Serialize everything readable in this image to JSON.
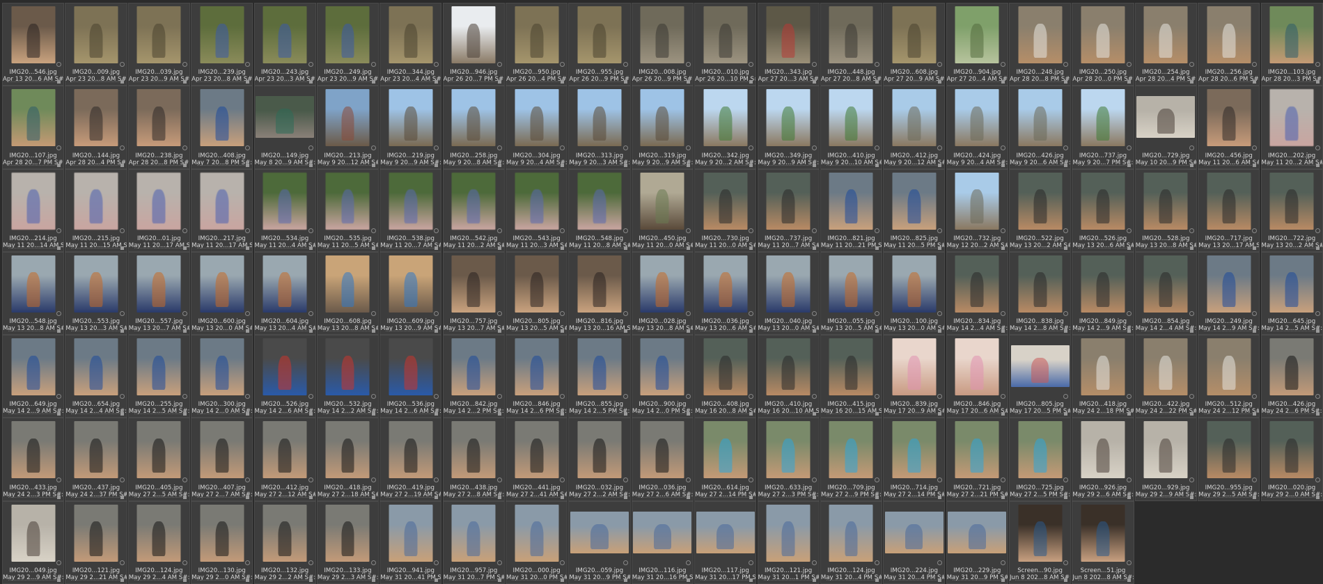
{
  "window": {
    "title": ""
  },
  "thumbnails": [
    {
      "name": "IMG20...546.jpg",
      "date": "Apr 13 20...6 AM S#:",
      "palette": "portrait-dark"
    },
    {
      "name": "IMG20...009.jpg",
      "date": "Apr 23 20...8 AM S#:",
      "palette": "forest"
    },
    {
      "name": "IMG20...039.jpg",
      "date": "Apr 23 20...9 AM S#:",
      "palette": "forest"
    },
    {
      "name": "IMG20...239.jpg",
      "date": "Apr 23 20...8 AM S#:",
      "palette": "forest-blue"
    },
    {
      "name": "IMG20...243.jpg",
      "date": "Apr 23 20...3 AM S#:",
      "palette": "forest-blue"
    },
    {
      "name": "IMG20...249.jpg",
      "date": "Apr 23 20...9 AM S#:",
      "palette": "forest-blue"
    },
    {
      "name": "IMG20...344.jpg",
      "date": "Apr 23 20...4 AM S#:",
      "palette": "forest"
    },
    {
      "name": "IMG20...946.jpg",
      "date": "Apr 26 20...7 PM S#:",
      "palette": "rock-sky"
    },
    {
      "name": "IMG20...950.jpg",
      "date": "Apr 26 20...4 PM S#:",
      "palette": "forest"
    },
    {
      "name": "IMG20...955.jpg",
      "date": "Apr 26 20...9 PM S#:",
      "palette": "forest"
    },
    {
      "name": "IMG20...008.jpg",
      "date": "Apr 26 20...9 PM S#:",
      "palette": "camp"
    },
    {
      "name": "IMG20...010.jpg",
      "date": "Apr 26 20...10 PM S#:",
      "palette": "camp"
    },
    {
      "name": "IMG20...343.jpg",
      "date": "Apr 27 20...3 AM S#:",
      "palette": "camp-red"
    },
    {
      "name": "IMG20...448.jpg",
      "date": "Apr 27 20...8 AM S#:",
      "palette": "camp"
    },
    {
      "name": "IMG20...608.jpg",
      "date": "Apr 27 20...9 AM S#:",
      "palette": "forest"
    },
    {
      "name": "IMG20...904.jpg",
      "date": "Apr 27 20...4 AM S#:",
      "palette": "green"
    },
    {
      "name": "IMG20...248.jpg",
      "date": "Apr 28 20...8 PM S#:",
      "palette": "boy-white"
    },
    {
      "name": "IMG20...250.jpg",
      "date": "Apr 28 20...0 PM S#:",
      "palette": "boy-white"
    },
    {
      "name": "IMG20...254.jpg",
      "date": "Apr 28 20...4 PM S#:",
      "palette": "boy-white"
    },
    {
      "name": "IMG20...256.jpg",
      "date": "Apr 28 20...6 PM S#:",
      "palette": "boy-white"
    },
    {
      "name": "IMG20...103.jpg",
      "date": "Apr 28 20...3 PM S#:",
      "palette": "boy-green"
    },
    {
      "name": "IMG20...107.jpg",
      "date": "Apr 28 20...7 PM S#:",
      "palette": "boy-green"
    },
    {
      "name": "IMG20...144.jpg",
      "date": "Apr 28 20...4 PM S#:",
      "palette": "group"
    },
    {
      "name": "IMG20...238.jpg",
      "date": "Apr 28 20...8 PM S#:",
      "palette": "group"
    },
    {
      "name": "IMG20...408.jpg",
      "date": "May 7 20...8 PM S#:",
      "palette": "portrait-blue"
    },
    {
      "name": "IMG20...149.jpg",
      "date": "May 8 20...9 AM S#:",
      "palette": "table",
      "wide": true
    },
    {
      "name": "IMG20...213.jpg",
      "date": "May 9 20...12 AM S#:",
      "palette": "truck"
    },
    {
      "name": "IMG20...219.jpg",
      "date": "May 9 20...9 AM S#:",
      "palette": "field-sky"
    },
    {
      "name": "IMG20...258.jpg",
      "date": "May 9 20...8 AM S#:",
      "palette": "field-sky"
    },
    {
      "name": "IMG20...304.jpg",
      "date": "May 9 20...4 AM S#:",
      "palette": "field-sky"
    },
    {
      "name": "IMG20...313.jpg",
      "date": "May 9 20...3 AM S#:",
      "palette": "field-sky"
    },
    {
      "name": "IMG20...319.jpg",
      "date": "May 9 20...9 AM S#:",
      "palette": "field-sky"
    },
    {
      "name": "IMG20...342.jpg",
      "date": "May 9 20...2 AM S#:",
      "palette": "field-tree"
    },
    {
      "name": "IMG20...349.jpg",
      "date": "May 9 20...9 AM S#:",
      "palette": "field-tree"
    },
    {
      "name": "IMG20...410.jpg",
      "date": "May 9 20...10 AM S#:",
      "palette": "field-tree"
    },
    {
      "name": "IMG20...412.jpg",
      "date": "May 9 20...12 AM S#:",
      "palette": "field-man"
    },
    {
      "name": "IMG20...424.jpg",
      "date": "May 9 20...4 AM S#:",
      "palette": "field-man"
    },
    {
      "name": "IMG20...426.jpg",
      "date": "May 9 20...6 AM S#:",
      "palette": "field-man"
    },
    {
      "name": "IMG20...737.jpg",
      "date": "May 9 20...7 PM S#:",
      "palette": "field-tree"
    },
    {
      "name": "IMG20...729.jpg",
      "date": "May 10 20...9 PM S#:",
      "palette": "hut",
      "wide": true
    },
    {
      "name": "IMG20...456.jpg",
      "date": "May 11 20...6 AM S#:",
      "palette": "group"
    },
    {
      "name": "IMG20...202.jpg",
      "date": "May 11 20...2 AM S#:",
      "palette": "blurred",
      "blur": true
    },
    {
      "name": "IMG20...214.jpg",
      "date": "May 11 20...14 AM S#:",
      "palette": "blurred",
      "blur": true
    },
    {
      "name": "IMG20...215.jpg",
      "date": "May 11 20...15 AM S#:",
      "palette": "blurred",
      "blur": true
    },
    {
      "name": "IMG20...01.jpg",
      "date": "May 11 20...17 AM S#:",
      "palette": "blurred",
      "blur": true
    },
    {
      "name": "IMG20...217.jpg",
      "date": "May 11 20...17 AM S#:",
      "palette": "blurred",
      "blur": true
    },
    {
      "name": "IMG20...534.jpg",
      "date": "May 11 20...4 AM S#:",
      "palette": "blurred-trees",
      "blur": true
    },
    {
      "name": "IMG20...535.jpg",
      "date": "May 11 20...5 AM S#:",
      "palette": "blurred-trees",
      "blur": true
    },
    {
      "name": "IMG20...538.jpg",
      "date": "May 11 20...7 AM S#:",
      "palette": "blurred-trees",
      "blur": true
    },
    {
      "name": "IMG20...542.jpg",
      "date": "May 11 20...2 AM S#:",
      "palette": "blurred-trees",
      "blur": true
    },
    {
      "name": "IMG20...543.jpg",
      "date": "May 11 20...3 AM S#:",
      "palette": "blurred-trees",
      "blur": true
    },
    {
      "name": "IMG20...548.jpg",
      "date": "May 11 20...8 AM S#:",
      "palette": "blurred-trees",
      "blur": true
    },
    {
      "name": "IMG20...450.jpg",
      "date": "May 11 20...0 AM S#:",
      "palette": "road"
    },
    {
      "name": "IMG20...730.jpg",
      "date": "May 11 20...0 AM S#:",
      "palette": "portrait-gear"
    },
    {
      "name": "IMG20...737.jpg",
      "date": "May 11 20...7 AM S#:",
      "palette": "portrait-gear"
    },
    {
      "name": "IMG20...821.jpg",
      "date": "May 11 20...21 PM S#:",
      "palette": "portrait-blue"
    },
    {
      "name": "IMG20...825.jpg",
      "date": "May 11 20...5 PM S#:",
      "palette": "portrait-blue"
    },
    {
      "name": "IMG20...732.jpg",
      "date": "May 12 20...2 AM S#:",
      "palette": "field-man"
    },
    {
      "name": "IMG20...522.jpg",
      "date": "May 13 20...2 AM S#:",
      "palette": "portrait-gear"
    },
    {
      "name": "IMG20...526.jpg",
      "date": "May 13 20...6 AM S#:",
      "palette": "portrait-gear"
    },
    {
      "name": "IMG20...528.jpg",
      "date": "May 13 20...8 AM S#:",
      "palette": "portrait-gear"
    },
    {
      "name": "IMG20...717.jpg",
      "date": "May 13 20...17 AM S#:",
      "palette": "portrait-gear"
    },
    {
      "name": "IMG20...722.jpg",
      "date": "May 13 20...2 AM S#:",
      "palette": "portrait-gear"
    },
    {
      "name": "IMG20...548.jpg",
      "date": "May 13 20...8 AM S#:",
      "palette": "portrait-orange"
    },
    {
      "name": "IMG20...553.jpg",
      "date": "May 13 20...3 AM S#:",
      "palette": "portrait-orange"
    },
    {
      "name": "IMG20...557.jpg",
      "date": "May 13 20...7 AM S#:",
      "palette": "portrait-orange"
    },
    {
      "name": "IMG20...600.jpg",
      "date": "May 13 20...0 AM S#:",
      "palette": "portrait-orange"
    },
    {
      "name": "IMG20...604.jpg",
      "date": "May 13 20...4 AM S#:",
      "palette": "portrait-orange"
    },
    {
      "name": "IMG20...608.jpg",
      "date": "May 13 20...8 AM S#:",
      "palette": "house"
    },
    {
      "name": "IMG20...609.jpg",
      "date": "May 13 20...9 AM S#:",
      "palette": "house"
    },
    {
      "name": "IMG20...757.jpg",
      "date": "May 13 20...7 AM S#:",
      "palette": "portrait-dark"
    },
    {
      "name": "IMG20...805.jpg",
      "date": "May 13 20...5 AM S#:",
      "palette": "portrait-dark"
    },
    {
      "name": "IMG20...816.jpg",
      "date": "May 13 20...16 AM S#:",
      "palette": "portrait-dark"
    },
    {
      "name": "IMG20...028.jpg",
      "date": "May 13 20...8 AM S#:",
      "palette": "portrait-orange"
    },
    {
      "name": "IMG20...036.jpg",
      "date": "May 13 20...6 AM S#:",
      "palette": "portrait-orange"
    },
    {
      "name": "IMG20...040.jpg",
      "date": "May 13 20...0 AM S#:",
      "palette": "portrait-orange"
    },
    {
      "name": "IMG20...055.jpg",
      "date": "May 13 20...5 AM S#:",
      "palette": "portrait-orange"
    },
    {
      "name": "IMG20...100.jpg",
      "date": "May 13 20...0 AM S#:",
      "palette": "portrait-orange"
    },
    {
      "name": "IMG20...834.jpg",
      "date": "May 14 2...4 AM S#:",
      "palette": "portrait-gear"
    },
    {
      "name": "IMG20...838.jpg",
      "date": "May 14 2...8 AM S#:",
      "palette": "portrait-gear"
    },
    {
      "name": "IMG20...849.jpg",
      "date": "May 14 2...9 AM S#:",
      "palette": "portrait-gear"
    },
    {
      "name": "IMG20...854.jpg",
      "date": "May 14 2...4 AM S#:",
      "palette": "portrait-gear"
    },
    {
      "name": "IMG20...249.jpg",
      "date": "May 14 2...9 AM S#:",
      "palette": "portrait-blue"
    },
    {
      "name": "IMG20...645.jpg",
      "date": "May 14 2...5 AM S#:",
      "palette": "portrait-blue"
    },
    {
      "name": "IMG20...649.jpg",
      "date": "May 14 2...9 AM S#:",
      "palette": "portrait-blue"
    },
    {
      "name": "IMG20...654.jpg",
      "date": "May 14 2...4 AM S#:",
      "palette": "portrait-blue"
    },
    {
      "name": "IMG20...255.jpg",
      "date": "May 14 2...5 AM S#:",
      "palette": "portrait-blue"
    },
    {
      "name": "IMG20...300.jpg",
      "date": "May 14 2...0 AM S#:",
      "palette": "portrait-blue"
    },
    {
      "name": "IMG20...526.jpg",
      "date": "May 14 2...6 AM S#:",
      "palette": "portrait-red"
    },
    {
      "name": "IMG20...532.jpg",
      "date": "May 14 2...2 AM S#:",
      "palette": "portrait-red"
    },
    {
      "name": "IMG20...536.jpg",
      "date": "May 14 2...6 AM S#:",
      "palette": "portrait-red"
    },
    {
      "name": "IMG20...842.jpg",
      "date": "May 14 2...2 PM S#:",
      "palette": "portrait-blue"
    },
    {
      "name": "IMG20...846.jpg",
      "date": "May 14 2...6 PM S#:",
      "palette": "portrait-blue"
    },
    {
      "name": "IMG20...855.jpg",
      "date": "May 14 2...5 PM S#:",
      "palette": "portrait-blue"
    },
    {
      "name": "IMG20...900.jpg",
      "date": "May 14 2...0 PM S#:",
      "palette": "portrait-blue"
    },
    {
      "name": "IMG20...408.jpg",
      "date": "May 16 20...8 AM S#:",
      "palette": "portrait-gear"
    },
    {
      "name": "IMG20...410.jpg",
      "date": "May 16 20...10 AM S#:",
      "palette": "portrait-gear"
    },
    {
      "name": "IMG20...415.jpg",
      "date": "May 16 20...15 AM S#:",
      "palette": "portrait-gear"
    },
    {
      "name": "IMG20...839.jpg",
      "date": "May 17 20...9 AM S#:",
      "palette": "girl-pink"
    },
    {
      "name": "IMG20...846.jpg",
      "date": "May 17 20...6 AM S#:",
      "palette": "girl-pink"
    },
    {
      "name": "IMG20...805.jpg",
      "date": "May 17 20...5 PM S#:",
      "palette": "kids",
      "wide": true
    },
    {
      "name": "IMG20...418.jpg",
      "date": "May 24 2...18 PM S#:",
      "palette": "boy-white"
    },
    {
      "name": "IMG20...422.jpg",
      "date": "May 24 2...22 PM S#:",
      "palette": "boy-white"
    },
    {
      "name": "IMG20...512.jpg",
      "date": "May 24 2...12 PM S#:",
      "palette": "boy-white"
    },
    {
      "name": "IMG20...426.jpg",
      "date": "May 24 2...6 PM S#:",
      "palette": "portrait-black"
    },
    {
      "name": "IMG20...433.jpg",
      "date": "May 24 2...3 PM S#:",
      "palette": "portrait-black"
    },
    {
      "name": "IMG20...437.jpg",
      "date": "May 24 2...37 PM S#:",
      "palette": "portrait-black"
    },
    {
      "name": "IMG20...405.jpg",
      "date": "May 27 2...5 AM S#:",
      "palette": "portrait-black"
    },
    {
      "name": "IMG20...407.jpg",
      "date": "May 27 2...7 AM S#:",
      "palette": "portrait-black"
    },
    {
      "name": "IMG20...412.jpg",
      "date": "May 27 2...12 AM S#:",
      "palette": "portrait-black"
    },
    {
      "name": "IMG20...418.jpg",
      "date": "May 27 2...18 AM S#:",
      "palette": "portrait-black"
    },
    {
      "name": "IMG20...419.jpg",
      "date": "May 27 2...19 AM S#:",
      "palette": "portrait-black"
    },
    {
      "name": "IMG20...438.jpg",
      "date": "May 27 2...8 AM S#:",
      "palette": "portrait-black"
    },
    {
      "name": "IMG20...441.jpg",
      "date": "May 27 2...41 AM S#:",
      "palette": "portrait-black"
    },
    {
      "name": "IMG20...032.jpg",
      "date": "May 27 2...2 AM S#:",
      "palette": "portrait-black"
    },
    {
      "name": "IMG20...036.jpg",
      "date": "May 27 2...6 AM S#:",
      "palette": "portrait-black"
    },
    {
      "name": "IMG20...614.jpg",
      "date": "May 27 2...14 PM S#:",
      "palette": "portrait-cyan"
    },
    {
      "name": "IMG20...633.jpg",
      "date": "May 27 2...3 PM S#:",
      "palette": "portrait-cyan"
    },
    {
      "name": "IMG20...709.jpg",
      "date": "May 27 2...9 PM S#:",
      "palette": "portrait-cyan"
    },
    {
      "name": "IMG20...714.jpg",
      "date": "May 27 2...14 PM S#:",
      "palette": "portrait-cyan"
    },
    {
      "name": "IMG20...721.jpg",
      "date": "May 27 2...21 PM S#:",
      "palette": "portrait-cyan"
    },
    {
      "name": "IMG20...725.jpg",
      "date": "May 27 2...5 PM S#:",
      "palette": "portrait-cyan"
    },
    {
      "name": "IMG20...926.jpg",
      "date": "May 29 2...6 AM S#:",
      "palette": "hut"
    },
    {
      "name": "IMG20...929.jpg",
      "date": "May 29 2...9 AM S#:",
      "palette": "hut"
    },
    {
      "name": "IMG20...955.jpg",
      "date": "May 29 2...5 AM S#:",
      "palette": "portrait-gear"
    },
    {
      "name": "IMG20...020.jpg",
      "date": "May 29 2...0 AM S#:",
      "palette": "portrait-gear"
    },
    {
      "name": "IMG20...049.jpg",
      "date": "May 29 2...9 AM S#:",
      "palette": "hut"
    },
    {
      "name": "IMG20...121.jpg",
      "date": "May 29 2...21 AM S#:",
      "palette": "portrait-black"
    },
    {
      "name": "IMG20...124.jpg",
      "date": "May 29 2...4 AM S#:",
      "palette": "portrait-black"
    },
    {
      "name": "IMG20...130.jpg",
      "date": "May 29 2...0 AM S#:",
      "palette": "portrait-black"
    },
    {
      "name": "IMG20...132.jpg",
      "date": "May 29 2...2 AM S#:",
      "palette": "portrait-black"
    },
    {
      "name": "IMG20...133.jpg",
      "date": "May 29 2...3 AM S#:",
      "palette": "portrait-black"
    },
    {
      "name": "IMG20...941.jpg",
      "date": "May 31 20...41 PM S#:",
      "palette": "portrait-denim"
    },
    {
      "name": "IMG20...957.jpg",
      "date": "May 31 20...7 PM S#:",
      "palette": "portrait-denim"
    },
    {
      "name": "IMG20...000.jpg",
      "date": "May 31 20...0 PM S#:",
      "palette": "portrait-denim"
    },
    {
      "name": "IMG20...059.jpg",
      "date": "May 31 20...9 PM S#:",
      "palette": "portrait-denim",
      "wide": true
    },
    {
      "name": "IMG20...116.jpg",
      "date": "May 31 20...16 PM S#:",
      "palette": "portrait-denim",
      "wide": true
    },
    {
      "name": "IMG20...117.jpg",
      "date": "May 31 20...17 PM S#:",
      "palette": "portrait-denim",
      "wide": true
    },
    {
      "name": "IMG20...121.jpg",
      "date": "May 31 20...1 PM S#:",
      "palette": "portrait-denim"
    },
    {
      "name": "IMG20...124.jpg",
      "date": "May 31 20...4 PM S#:",
      "palette": "portrait-denim"
    },
    {
      "name": "IMG20...224.jpg",
      "date": "May 31 20...4 PM S#:",
      "palette": "portrait-denim",
      "wide": true
    },
    {
      "name": "IMG20...229.jpg",
      "date": "May 31 20...9 PM S#:",
      "palette": "portrait-denim",
      "wide": true
    },
    {
      "name": "Screen...90.jpg",
      "date": "Jun 8 202...8 AM S#:",
      "palette": "screen"
    },
    {
      "name": "Screen...51.jpg",
      "date": "Jun 8 202...8 AM S#:",
      "palette": "screen"
    }
  ],
  "palettes": {
    "portrait-dark": [
      "#6b5a4a",
      "#2a2320",
      "#c9a27e"
    ],
    "forest": [
      "#7d7255",
      "#4a4330",
      "#a5956c"
    ],
    "forest-blue": [
      "#5d6d3c",
      "#3a5aa8",
      "#8a8b5a"
    ],
    "rock-sky": [
      "#e9ecef",
      "#4a4036",
      "#8a7a66"
    ],
    "camp": [
      "#6f6a5a",
      "#3a3833",
      "#9c9380"
    ],
    "camp-red": [
      "#5d5847",
      "#b63a34",
      "#9a8f77"
    ],
    "green": [
      "#7fa06a",
      "#536b3e",
      "#b7c39d"
    ],
    "boy-white": [
      "#8a7f6d",
      "#e8e6e0",
      "#b58e68"
    ],
    "boy-green": [
      "#6f8a5a",
      "#2f5d6a",
      "#c49a74"
    ],
    "group": [
      "#7b6a5a",
      "#2f2a28",
      "#c79b7a"
    ],
    "portrait-blue": [
      "#6c7a86",
      "#1f4a9a",
      "#c8a07c"
    ],
    "table": [
      "#4a5a4a",
      "#2d6b58",
      "#8a8078"
    ],
    "truck": [
      "#7fa3c8",
      "#8a4a3a",
      "#6b5a48"
    ],
    "field-sky": [
      "#9ec3e6",
      "#5a4a38",
      "#7a6a52"
    ],
    "field-tree": [
      "#bcd7ef",
      "#3f7a34",
      "#8a7860"
    ],
    "field-man": [
      "#a9cbe8",
      "#6b6a5a",
      "#8a7860"
    ],
    "hut": [
      "#b7b2a8",
      "#4a4038",
      "#d8d2c6"
    ],
    "blurred": [
      "#b8b2ac",
      "#4a5fb0",
      "#c9a5a0"
    ],
    "blurred-trees": [
      "#4d6a3a",
      "#5a68b0",
      "#c9a5a0"
    ],
    "road": [
      "#b0a994",
      "#6a7a52",
      "#5a4a3a"
    ],
    "portrait-gear": [
      "#546058",
      "#2a2a2a",
      "#b88a64"
    ],
    "portrait-orange": [
      "#9aa8b0",
      "#c66a26",
      "#2a3a6a"
    ],
    "house": [
      "#c9a478",
      "#2f78c6",
      "#6b5a4a"
    ],
    "portrait-red": [
      "#4a4a4a",
      "#c8342e",
      "#2a5aa8"
    ],
    "girl-pink": [
      "#e9d6cc",
      "#e091b0",
      "#c89a82"
    ],
    "kids": [
      "#d8d2c8",
      "#c85a5a",
      "#4a6aa8"
    ],
    "portrait-black": [
      "#7a7a74",
      "#151515",
      "#c29a78"
    ],
    "portrait-cyan": [
      "#7a8a6a",
      "#2fa6d8",
      "#c49a76"
    ],
    "portrait-denim": [
      "#8a9aa8",
      "#4a6a9a",
      "#c8a078"
    ],
    "screen": [
      "#3a3028",
      "#2a5a8a",
      "#c8a080"
    ]
  }
}
